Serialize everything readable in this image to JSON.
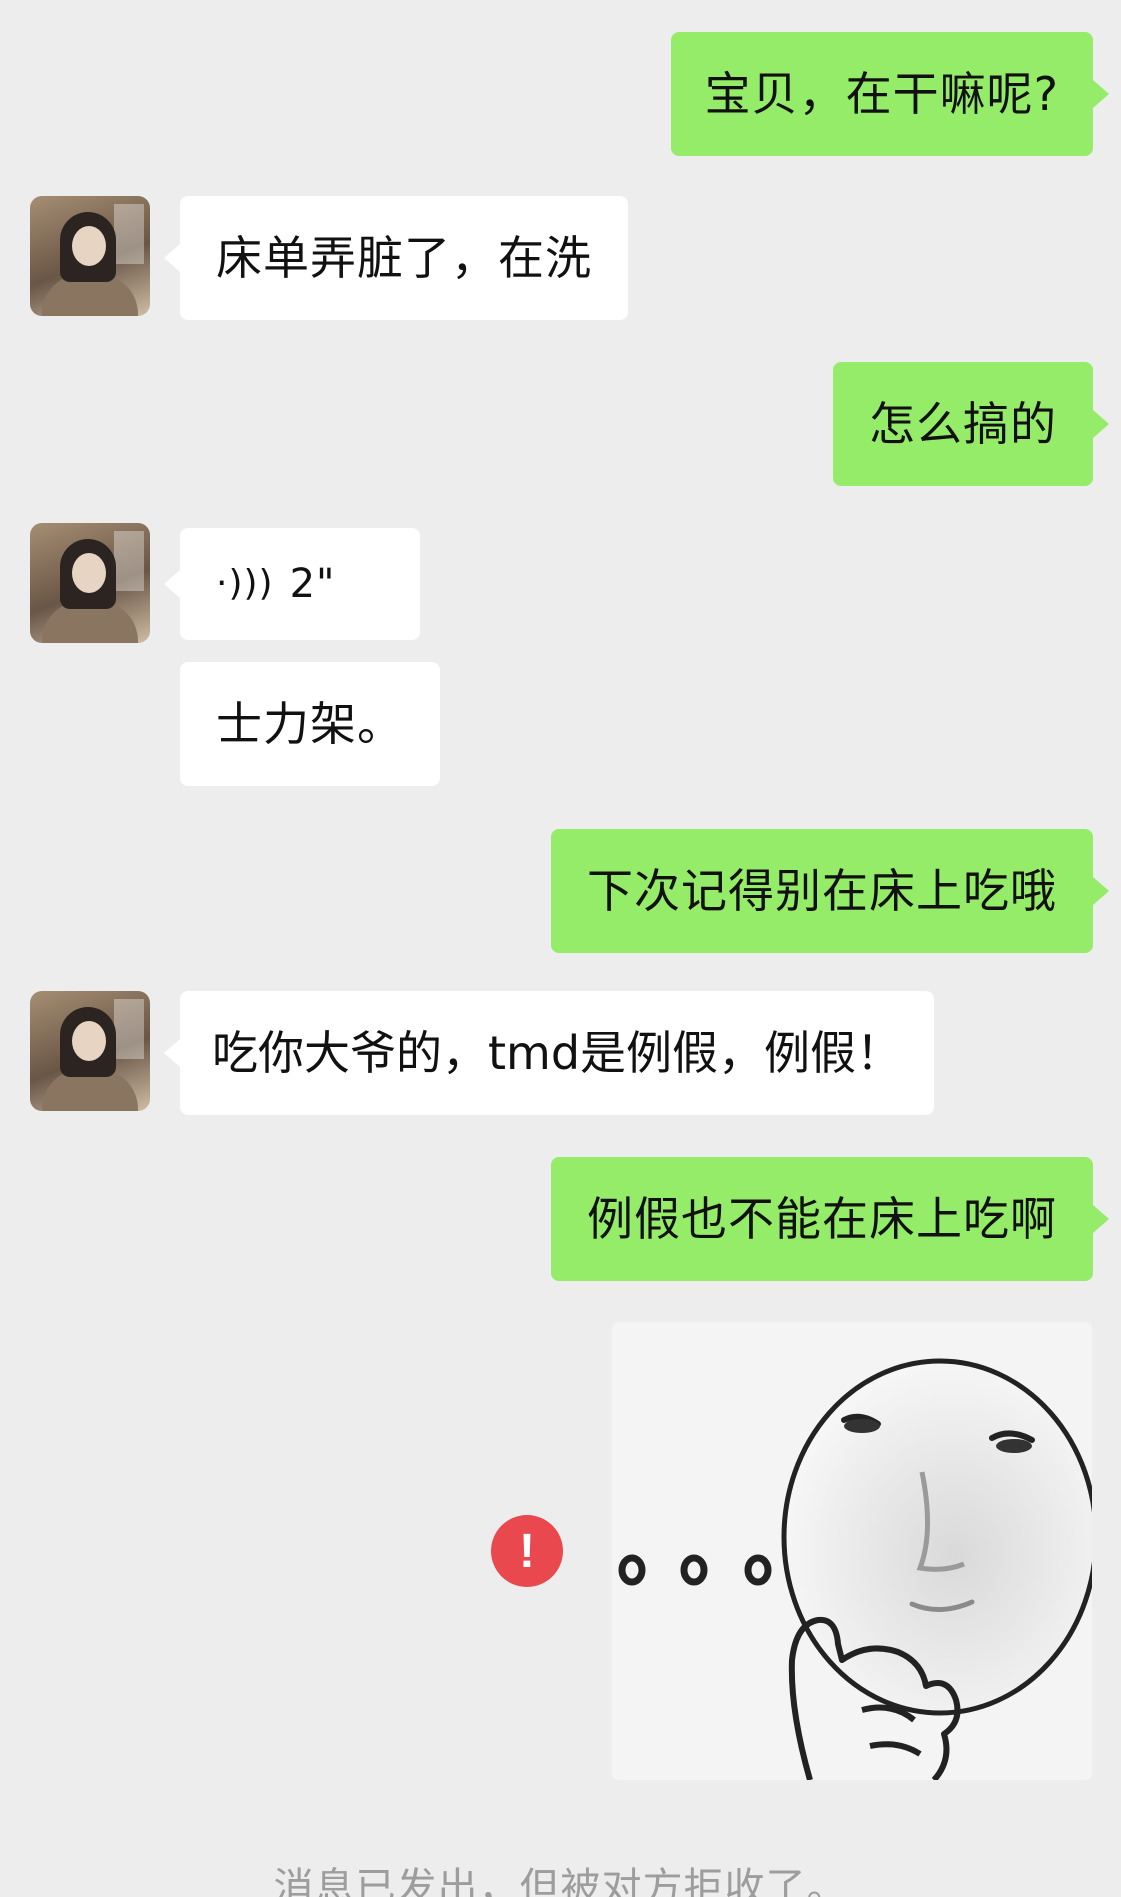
{
  "messages": [
    {
      "id": "m1",
      "side": "out",
      "text": "宝贝，在干嘛呢?"
    },
    {
      "id": "m2",
      "side": "in",
      "text": "床单弄脏了，在洗"
    },
    {
      "id": "m3",
      "side": "out",
      "text": "怎么搞的"
    },
    {
      "id": "m4",
      "side": "in",
      "type": "voice",
      "icon": "voice-wave-icon",
      "duration": "2\""
    },
    {
      "id": "m5",
      "side": "in",
      "text": "士力架。"
    },
    {
      "id": "m6",
      "side": "out",
      "text": "下次记得别在床上吃哦"
    },
    {
      "id": "m7",
      "side": "in",
      "text": "吃你大爷的，tmd是例假，例假！"
    },
    {
      "id": "m8",
      "side": "out",
      "text": "例假也不能在床上吃啊"
    },
    {
      "id": "m9",
      "side": "out",
      "type": "sticker",
      "icon": "meme-face-sticker",
      "status_icon": "error-icon",
      "status_glyph": "!"
    }
  ],
  "system_note": "消息已发出，但被对方拒收了。",
  "colors": {
    "background": "#ededed",
    "outgoing_bubble": "#95ec69",
    "incoming_bubble": "#ffffff",
    "error": "#e9484f",
    "system_text": "#9d9d9d"
  }
}
